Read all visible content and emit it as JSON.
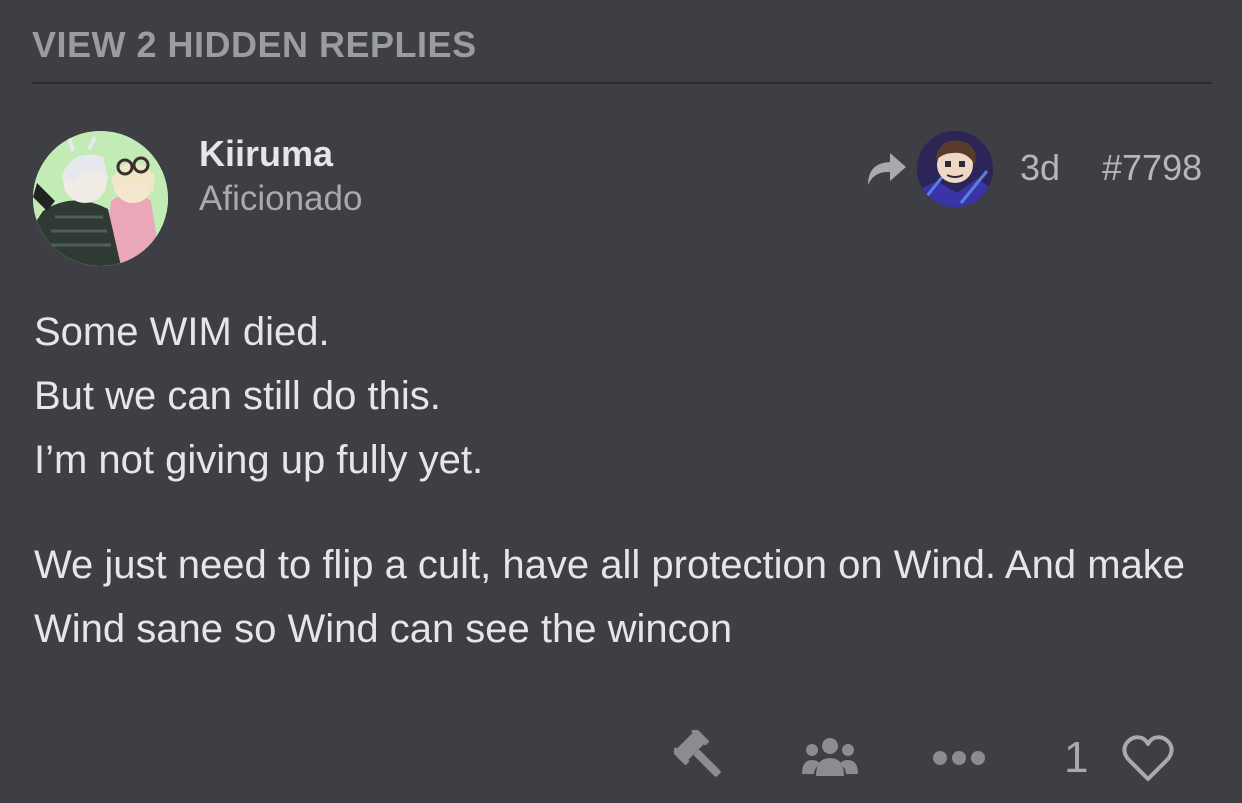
{
  "hidden_replies": {
    "label": "VIEW 2 HIDDEN REPLIES"
  },
  "post": {
    "author": {
      "username": "Kiiruma",
      "title": "Aficionado",
      "avatar_icon": "user-avatar"
    },
    "reply_to": {
      "icon": "reply-arrow-icon",
      "avatar_icon": "reply-to-avatar"
    },
    "age": "3d",
    "number": "#7798",
    "paragraphs": [
      {
        "lines": [
          "Some WIM died.",
          "But we can still do this.",
          "I’m not giving up fully yet."
        ]
      },
      {
        "lines": [
          "We just need to flip a cult, have all protection on Wind. And make Wind sane so Wind can see the wincon"
        ]
      }
    ]
  },
  "actions": {
    "moderate_icon": "gavel-icon",
    "group_icon": "users-icon",
    "more_icon": "ellipsis-icon",
    "like_count": "1",
    "like_icon": "heart-icon"
  },
  "colors": {
    "background": "#3d3f44",
    "text": "#e6e6e8",
    "muted": "#a8aaaf",
    "divider": "#2a2b2f"
  }
}
